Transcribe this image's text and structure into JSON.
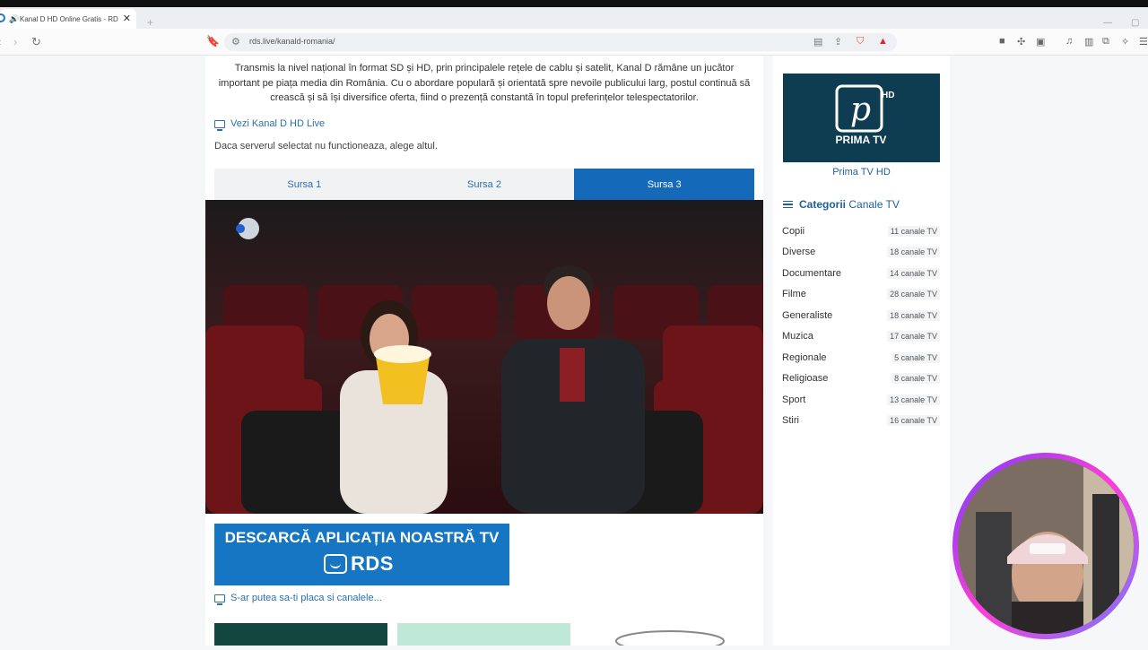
{
  "browser": {
    "tab_title": "Kanal D HD Online Gratis - RD",
    "url": "rds.live/kanald-romania/"
  },
  "content": {
    "intro": "Transmis la nivel național în format SD și HD, prin principalele rețele de cablu și satelit, Kanal D rămâne un jucător important pe piața media din România. Cu o abordare populară și orientată spre nevoile publicului larg, postul continuă să crească și să își diversifice oferta, fiind o prezență constantă în topul preferințelor telespectatorilor.",
    "live_link": "Vezi Kanal D HD Live",
    "server_hint": "Daca serverul selectat nu functioneaza, alege altul.",
    "source_tabs": [
      {
        "label": "Sursa 1",
        "active": false
      },
      {
        "label": "Sursa 2",
        "active": false
      },
      {
        "label": "Sursa 3",
        "active": true
      }
    ],
    "banner_title": "DESCARCĂ APLICAȚIA NOASTRĂ TV",
    "banner_logo": "RDS",
    "more_link": "S-ar putea sa-ti placa si canalele..."
  },
  "sidebar": {
    "featured_caption": "Prima TV HD",
    "featured_logo_text": "PRIMA TV",
    "categories_title_bold": "Categorii",
    "categories_title_rest": "Canale TV",
    "categories": [
      {
        "name": "Copii",
        "count": "11 canale TV"
      },
      {
        "name": "Diverse",
        "count": "18 canale TV"
      },
      {
        "name": "Documentare",
        "count": "14 canale TV"
      },
      {
        "name": "Filme",
        "count": "28 canale TV"
      },
      {
        "name": "Generaliste",
        "count": "18 canale TV"
      },
      {
        "name": "Muzica",
        "count": "17 canale TV"
      },
      {
        "name": "Regionale",
        "count": "5 canale TV"
      },
      {
        "name": "Religioase",
        "count": "8 canale TV"
      },
      {
        "name": "Sport",
        "count": "13 canale TV"
      },
      {
        "name": "Stiri",
        "count": "16 canale TV"
      }
    ]
  },
  "colors": {
    "accent": "#1469b8",
    "link": "#2a6fb0",
    "banner": "#1676c4"
  }
}
